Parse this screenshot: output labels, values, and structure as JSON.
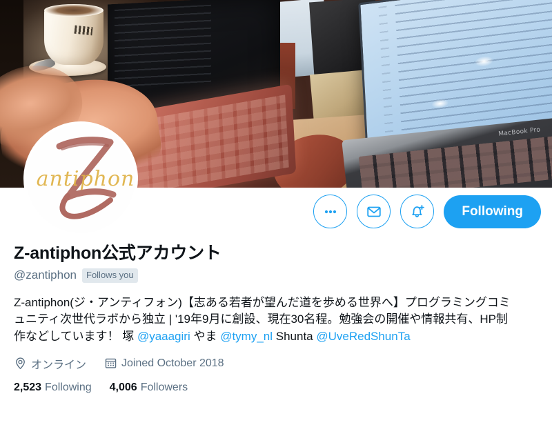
{
  "profile": {
    "display_name": "Z-antiphon公式アカウント",
    "handle": "@zantiphon",
    "follows_you_badge": "Follows you",
    "avatar": {
      "logo_letter": "Z",
      "logo_word": "antiphon",
      "letter_color": "#b06a62",
      "word_color": "#e0b44a"
    },
    "bio": {
      "segment_1": "Z-antiphon(ジ・アンティフォン)【志ある若者が望んだ道を歩める世界へ】プログラミングコミュニティ次世代ラボから独立 | '19年9月に創設、現在30名程。勉強会の開催や情報共有、HP制作などしています！ 塚 ",
      "mention_1": "@yaaagiri",
      "segment_2": " やま ",
      "mention_2": "@tymy_nl",
      "segment_3": " Shunta ",
      "mention_3": "@UveRedShunTa"
    },
    "location": "オンライン",
    "joined": "Joined October 2018",
    "stats": {
      "following_count": "2,523",
      "following_label": "Following",
      "followers_count": "4,006",
      "followers_label": "Followers"
    }
  },
  "actions": {
    "more_label": "more-options",
    "message_label": "message",
    "notify_label": "notifications",
    "follow_button": "Following"
  },
  "colors": {
    "accent": "#1DA1F2",
    "text_primary": "#0F1419",
    "text_secondary": "#5B7083",
    "badge_bg": "#E1E8ED"
  }
}
